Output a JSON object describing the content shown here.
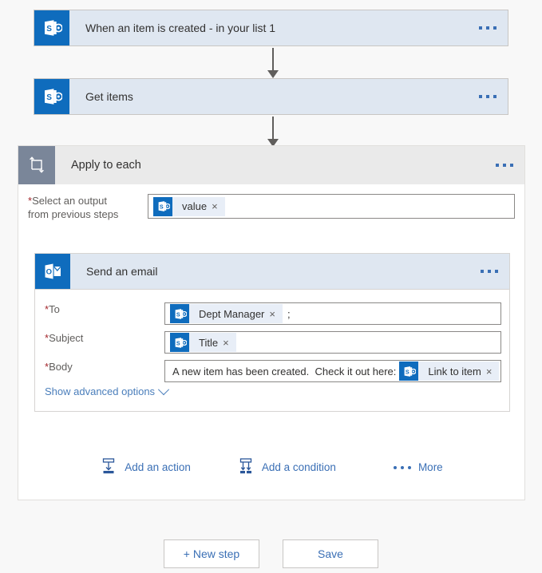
{
  "flow": {
    "trigger": {
      "title": "When an item is created - in your list 1",
      "icon": "sharepoint-icon",
      "menu": "ellipsis-menu"
    },
    "get_items": {
      "title": "Get items",
      "icon": "sharepoint-icon",
      "menu": "ellipsis-menu"
    },
    "apply_to_each": {
      "title": "Apply to each",
      "icon": "loop-icon",
      "menu": "ellipsis-menu",
      "select_output": {
        "label_required": "*",
        "label_line1": "Select an output",
        "label_line2": "from previous steps",
        "token": {
          "text": "value",
          "icon": "sharepoint-icon",
          "remove": "×"
        }
      },
      "send_email": {
        "title": "Send an email",
        "icon": "outlook-icon",
        "menu": "ellipsis-menu",
        "fields": [
          {
            "required": "*",
            "label": "To",
            "token": {
              "text": "Dept Manager",
              "icon": "sharepoint-icon",
              "remove": "×"
            },
            "trailing_text": ";"
          },
          {
            "required": "*",
            "label": "Subject",
            "token": {
              "text": "Title",
              "icon": "sharepoint-icon",
              "remove": "×"
            },
            "trailing_text": ""
          },
          {
            "required": "*",
            "label": "Body",
            "leading_text": "A new item has been created.  Check it out here:",
            "token": {
              "text": "Link to item",
              "icon": "sharepoint-icon",
              "remove": "×"
            },
            "trailing_text": ""
          }
        ],
        "show_advanced_label": "Show advanced options"
      }
    },
    "actions": {
      "add_action": "Add an action",
      "add_condition": "Add a condition",
      "more": "More"
    }
  },
  "footer": {
    "new_step": "+ New step",
    "save": "Save"
  },
  "colors": {
    "accent_blue": "#0f6cbd",
    "card_blue": "#dfe7f1",
    "link_blue": "#3a6fb5",
    "loop_gray": "#7a8699",
    "required_red": "#a4262c",
    "page_bg": "#f8f8f8"
  }
}
